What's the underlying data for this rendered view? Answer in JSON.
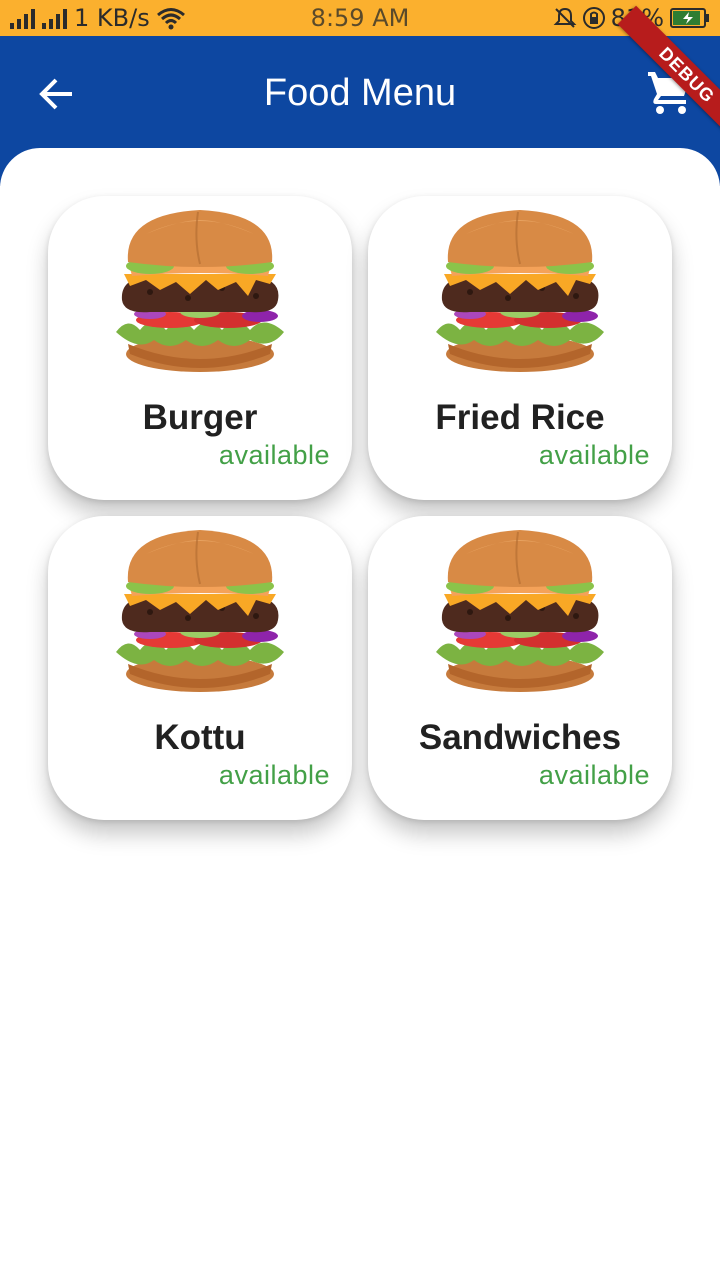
{
  "status_bar": {
    "network_speed": "1 KB/s",
    "time": "8:59 AM",
    "battery": "81%"
  },
  "app_bar": {
    "title": "Food Menu",
    "debug_label": "DEBUG",
    "back_icon": "arrow-back-icon",
    "cart_icon": "shopping-cart-icon"
  },
  "colors": {
    "primary": "#0D47A1",
    "status_bar": "#FBB02E",
    "available": "#43A047"
  },
  "menu": {
    "items": [
      {
        "name": "Burger",
        "status": "available"
      },
      {
        "name": "Fried Rice",
        "status": "available"
      },
      {
        "name": "Kottu",
        "status": "available"
      },
      {
        "name": "Sandwiches",
        "status": "available"
      }
    ]
  }
}
